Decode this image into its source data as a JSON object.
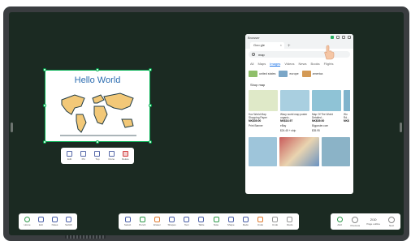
{
  "whiteboard": {
    "title": "Hello World",
    "toolbar": [
      {
        "label": "Edit",
        "icon": "edit-icon"
      },
      {
        "label": "Pin",
        "icon": "pin-icon"
      },
      {
        "label": "Top",
        "icon": "top-icon"
      },
      {
        "label": "Clone",
        "icon": "clone-icon"
      },
      {
        "label": "Delete",
        "icon": "delete-icon"
      }
    ]
  },
  "browser": {
    "window_title": "Browser",
    "tab_title": "Goo gle",
    "search_query": "map",
    "search_tabs": [
      "All",
      "Maps",
      "Images",
      "Videos",
      "News",
      "Books",
      "Flights"
    ],
    "active_tab": "Images",
    "chips": [
      {
        "label": "united states",
        "color": "#8fbf6a"
      },
      {
        "label": "europe",
        "color": "#7aa6c7"
      },
      {
        "label": "america",
        "color": "#d49a55"
      }
    ],
    "shop_heading": "Shop map",
    "products": [
      {
        "title": "Kov World Map Shopping Paper",
        "price": "NK$39.00",
        "seller": "Print Banner",
        "color": "#dfe9c8"
      },
      {
        "title": "Wavy world map poster organiz...",
        "price": "NK$16.97",
        "seller": "eBay",
        "extra": "$24.45 + ship",
        "color": "#a9cfe0"
      },
      {
        "title": "Map Of The World Detailed...",
        "price": "NK$39.00",
        "seller": "Bigposter.com",
        "extra": "$35.95",
        "color": "#8fc3d6"
      },
      {
        "title": "Wo Rd...",
        "price": "NK$",
        "seller": "",
        "color": "#7fb3cc"
      }
    ],
    "images": [
      "#9ec5da",
      "#c95b5b",
      "#8bb3c7"
    ]
  },
  "toolbars": {
    "left": [
      "Home",
      "Exit",
      "Notes",
      "Switch"
    ],
    "center": [
      "Select",
      "Pencil",
      "Eraser",
      "Shapes",
      "Text",
      "Table",
      "Note",
      "Shape",
      "Redo",
      "Undo",
      "Undo",
      "Redo"
    ],
    "right": {
      "buttons": [
        "Add",
        "Previous"
      ],
      "page": "2/10",
      "nav": [
        "Page outline",
        "Next"
      ]
    }
  }
}
